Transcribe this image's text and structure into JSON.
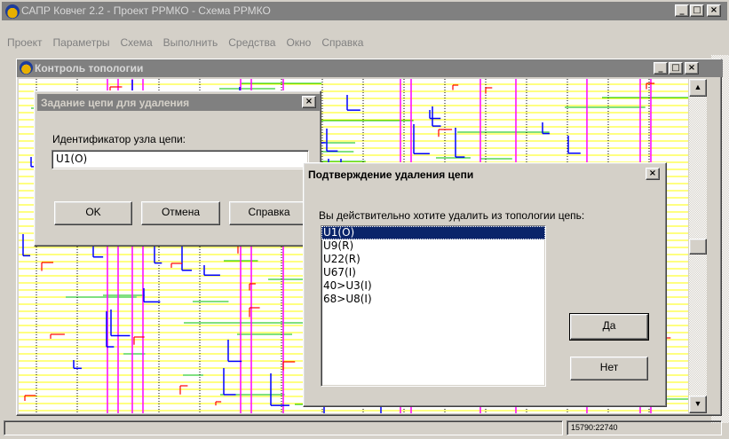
{
  "app": {
    "title": "САПР Ковчег 2.2 - Проект РРМКО - Схема РРМКО",
    "icon": "ark-logo-icon",
    "controls": {
      "minimize": "_",
      "maximize": "□",
      "close": "×"
    }
  },
  "menu": {
    "items": [
      "Проект",
      "Параметры",
      "Схема",
      "Выполнить",
      "Средства",
      "Окно",
      "Справка"
    ]
  },
  "child_window": {
    "title": "Контроль топологии",
    "icon": "ark-logo-icon",
    "controls": {
      "minimize": "_",
      "maximize": "□",
      "close": "×"
    }
  },
  "scrollbar": {
    "up": "▲",
    "down": "▼"
  },
  "statusbar": {
    "coordinates": "15790:22740"
  },
  "dialog_net_delete": {
    "title": "Задание цепи для удаления",
    "close": "×",
    "label": "Идентификатор узла цепи:",
    "input_value": "U1(O)",
    "buttons": {
      "ok": "OK",
      "cancel": "Отмена",
      "help": "Справка"
    }
  },
  "dialog_confirm": {
    "title": "Подтверждение удаления цепи",
    "close": "×",
    "question": "Вы действительно хотите удалить из топологии цепь:",
    "nets": [
      "U1(O)",
      "U9(R)",
      "U22(R)",
      "U67(I)",
      "40>U3(I)",
      "68>U8(I)"
    ],
    "selected_index": 0,
    "buttons": {
      "yes": "Да",
      "no": "Нет"
    }
  },
  "colors": {
    "trace_blue": "#0000ff",
    "trace_red": "#ff0000",
    "trace_magenta": "#ff00ff",
    "trace_yellow": "#ffff00",
    "trace_green": "#00c000",
    "selection": "#0a246a",
    "inactive_title": "#808080"
  }
}
